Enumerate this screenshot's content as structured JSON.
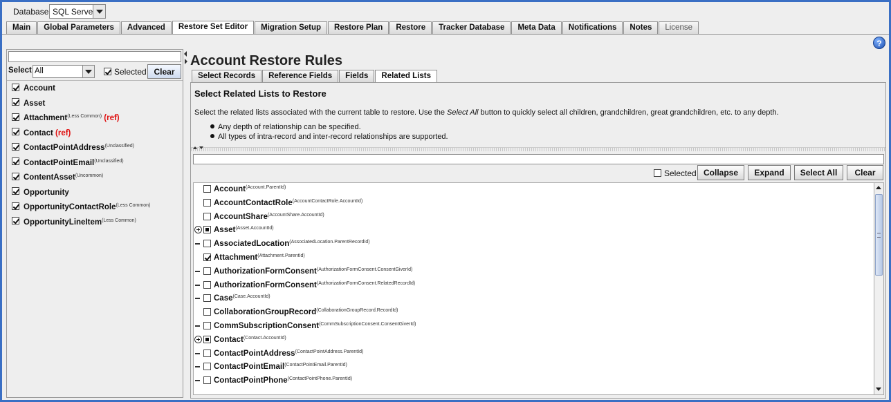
{
  "database": {
    "label": "Database",
    "value": "SQL Server"
  },
  "tabs": [
    {
      "label": "Main"
    },
    {
      "label": "Global Parameters"
    },
    {
      "label": "Advanced"
    },
    {
      "label": "Restore Set Editor"
    },
    {
      "label": "Migration Setup"
    },
    {
      "label": "Restore Plan"
    },
    {
      "label": "Restore"
    },
    {
      "label": "Tracker Database"
    },
    {
      "label": "Meta Data"
    },
    {
      "label": "Notifications"
    },
    {
      "label": "Notes"
    },
    {
      "label": "License"
    }
  ],
  "help_icon": "help-icon",
  "left_panel": {
    "search_value": "",
    "select_label": "Select:",
    "select_value": "All",
    "selected_label": "Selected",
    "clear_label": "Clear",
    "items": [
      {
        "name": "Account",
        "note": "",
        "ref": ""
      },
      {
        "name": "Asset",
        "note": "",
        "ref": ""
      },
      {
        "name": "Attachment",
        "note": "(Less Common)",
        "ref": "(ref)"
      },
      {
        "name": "Contact",
        "note": "",
        "ref": "(ref)"
      },
      {
        "name": "ContactPointAddress",
        "note": "(Unclassified)",
        "ref": ""
      },
      {
        "name": "ContactPointEmail",
        "note": "(Unclassified)",
        "ref": ""
      },
      {
        "name": "ContentAsset",
        "note": "(Uncommon)",
        "ref": ""
      },
      {
        "name": "Opportunity",
        "note": "",
        "ref": ""
      },
      {
        "name": "OpportunityContactRole",
        "note": "(Less Common)",
        "ref": ""
      },
      {
        "name": "OpportunityLineItem",
        "note": "(Less Common)",
        "ref": ""
      }
    ]
  },
  "right_panel": {
    "title": "Account Restore Rules",
    "subtabs": [
      {
        "label": "Select Records"
      },
      {
        "label": "Reference Fields"
      },
      {
        "label": "Fields"
      },
      {
        "label": "Related Lists"
      }
    ],
    "heading": "Select Related Lists to Restore",
    "desc_part1": "Select the related lists associated with the current table to restore. Use the ",
    "desc_italic": "Select All",
    "desc_part2": " button to quickly select all children, grandchildren, great grandchildren, etc. to any depth.",
    "bullets": [
      "Any depth of relationship can be specified.",
      "All types of intra-record and inter-record relationships are supported."
    ],
    "search_value": "",
    "selected_label": "Selected",
    "buttons": {
      "collapse": "Collapse",
      "expand": "Expand",
      "select_all": "Select All",
      "clear": "Clear"
    },
    "items": [
      {
        "name": "Account",
        "note": "(Account.ParentId)",
        "expander": "",
        "state": "unchecked"
      },
      {
        "name": "AccountContactRole",
        "note": "(AccountContactRole.AccountId)",
        "expander": "",
        "state": "unchecked"
      },
      {
        "name": "AccountShare",
        "note": "(AccountShare.AccountId)",
        "expander": "",
        "state": "unchecked"
      },
      {
        "name": "Asset",
        "note": "(Asset.AccountId)",
        "expander": "plus",
        "state": "partial"
      },
      {
        "name": "AssociatedLocation",
        "note": "(AssociatedLocation.ParentRecordId)",
        "expander": "dash",
        "state": "unchecked"
      },
      {
        "name": "Attachment",
        "note": "(Attachment.ParentId)",
        "expander": "",
        "state": "checked"
      },
      {
        "name": "AuthorizationFormConsent",
        "note": "(AuthorizationFormConsent.ConsentGiverId)",
        "expander": "dash",
        "state": "unchecked"
      },
      {
        "name": "AuthorizationFormConsent",
        "note": "(AuthorizationFormConsent.RelatedRecordId)",
        "expander": "dash",
        "state": "unchecked"
      },
      {
        "name": "Case",
        "note": "(Case.AccountId)",
        "expander": "dash",
        "state": "unchecked"
      },
      {
        "name": "CollaborationGroupRecord",
        "note": "(CollaborationGroupRecord.RecordId)",
        "expander": "",
        "state": "unchecked"
      },
      {
        "name": "CommSubscriptionConsent",
        "note": "(CommSubscriptionConsent.ConsentGiverId)",
        "expander": "dash",
        "state": "unchecked"
      },
      {
        "name": "Contact",
        "note": "(Contact.AccountId)",
        "expander": "plus",
        "state": "partial"
      },
      {
        "name": "ContactPointAddress",
        "note": "(ContactPointAddress.ParentId)",
        "expander": "dash",
        "state": "unchecked"
      },
      {
        "name": "ContactPointEmail",
        "note": "(ContactPointEmail.ParentId)",
        "expander": "dash",
        "state": "unchecked"
      },
      {
        "name": "ContactPointPhone",
        "note": "(ContactPointPhone.ParentId)",
        "expander": "dash",
        "state": "unchecked"
      }
    ]
  }
}
